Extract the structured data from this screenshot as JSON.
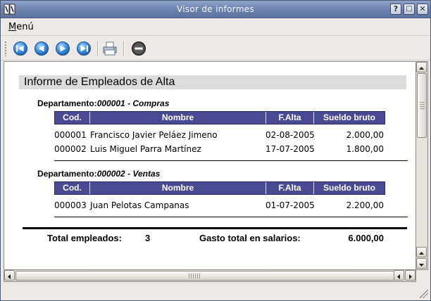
{
  "window": {
    "title": "Visor de informes",
    "controls": {
      "help": "?",
      "maximize": "□",
      "close": "✕"
    }
  },
  "menu": {
    "label_u": "M",
    "label_rest": "enú"
  },
  "toolbar": {
    "icons": [
      "first-page-icon",
      "previous-page-icon",
      "next-page-icon",
      "last-page-icon",
      "print-icon",
      "stop-icon"
    ]
  },
  "report": {
    "title": "Informe de Empleados de Alta",
    "columns": [
      "Cod.",
      "Nombre",
      "F.Alta",
      "Sueldo bruto"
    ],
    "departments": [
      {
        "label": "Departamento:",
        "value": "000001 - Compras",
        "rows": [
          {
            "cod": "000001",
            "nombre": "Francisco Javier Peláez Jimeno",
            "falta": "02-08-2005",
            "sueldo": "2.000,00"
          },
          {
            "cod": "000002",
            "nombre": "Luis Miguel Parra Martínez",
            "falta": "17-07-2005",
            "sueldo": "1.800,00"
          }
        ]
      },
      {
        "label": "Departamento:",
        "value": "000002 - Ventas",
        "rows": [
          {
            "cod": "000003",
            "nombre": "Juan Pelotas Campanas",
            "falta": "01-07-2005",
            "sueldo": "2.200,00"
          }
        ]
      }
    ],
    "totals": {
      "empleados_label": "Total empleados:",
      "empleados_value": "3",
      "gasto_label": "Gasto total en salarios:",
      "gasto_value": "6.000,00"
    }
  },
  "colors": {
    "header_bg": "#4a4a94",
    "title_bar_bg": "#dcdcdc",
    "titlebar_gradient": "#6a81ae"
  }
}
